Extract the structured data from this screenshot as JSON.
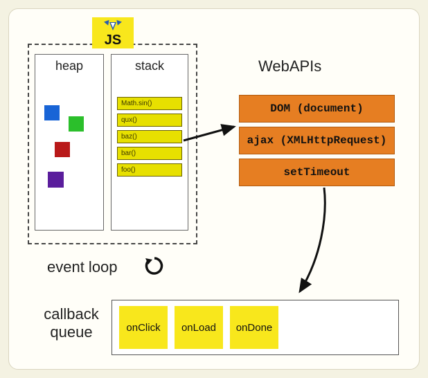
{
  "js_label": "JS",
  "heap": {
    "title": "heap"
  },
  "stack": {
    "title": "stack",
    "frames": [
      "Math.sin()",
      "qux()",
      "baz()",
      "bar()",
      "foo()"
    ]
  },
  "webapis": {
    "title": "WebAPIs",
    "items": [
      "DOM (document)",
      "ajax (XMLHttpRequest)",
      "setTimeout"
    ]
  },
  "eventloop": "event loop",
  "callback_queue": {
    "title": "callback queue",
    "items": [
      "onClick",
      "onLoad",
      "onDone"
    ]
  }
}
